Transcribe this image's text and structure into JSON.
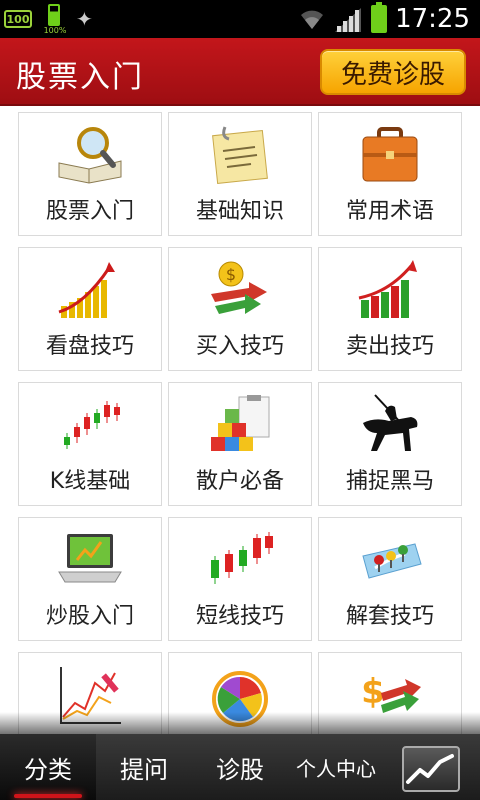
{
  "status_bar": {
    "battery_small_badge": "100",
    "battery_percent": "100%",
    "clock": "17:25",
    "icons": [
      "battery-100-icon",
      "battery-charging-icon",
      "usb-icon",
      "wifi-icon",
      "signal-icon",
      "battery-icon"
    ]
  },
  "header": {
    "title": "股票入门",
    "action_label": "免费诊股",
    "colors": {
      "bar": "#b3121a",
      "button": "#f9b91a"
    }
  },
  "grid": {
    "items": [
      {
        "label": "股票入门",
        "icon": "book-magnifier-icon"
      },
      {
        "label": "基础知识",
        "icon": "note-paper-icon"
      },
      {
        "label": "常用术语",
        "icon": "briefcase-icon"
      },
      {
        "label": "看盘技巧",
        "icon": "rising-bars-icon"
      },
      {
        "label": "买入技巧",
        "icon": "dollar-arrows-icon"
      },
      {
        "label": "卖出技巧",
        "icon": "red-green-bars-icon"
      },
      {
        "label": "K线基础",
        "icon": "candlestick-icon"
      },
      {
        "label": "散户必备",
        "icon": "blocks-clipboard-icon"
      },
      {
        "label": "捕捉黑马",
        "icon": "horse-rider-icon"
      },
      {
        "label": "炒股入门",
        "icon": "laptop-chart-icon"
      },
      {
        "label": "短线技巧",
        "icon": "candles-icon"
      },
      {
        "label": "解套技巧",
        "icon": "map-pins-icon"
      },
      {
        "label": "",
        "icon": "line-chart-icon"
      },
      {
        "label": "",
        "icon": "color-wheel-icon"
      },
      {
        "label": "",
        "icon": "dollar-arrows-icon"
      }
    ]
  },
  "tabbar": {
    "tabs": [
      {
        "label": "分类",
        "active": true
      },
      {
        "label": "提问",
        "active": false
      },
      {
        "label": "诊股",
        "active": false
      },
      {
        "label": "个人中心",
        "active": false
      }
    ],
    "chart_button_icon": "trend-chart-icon"
  }
}
